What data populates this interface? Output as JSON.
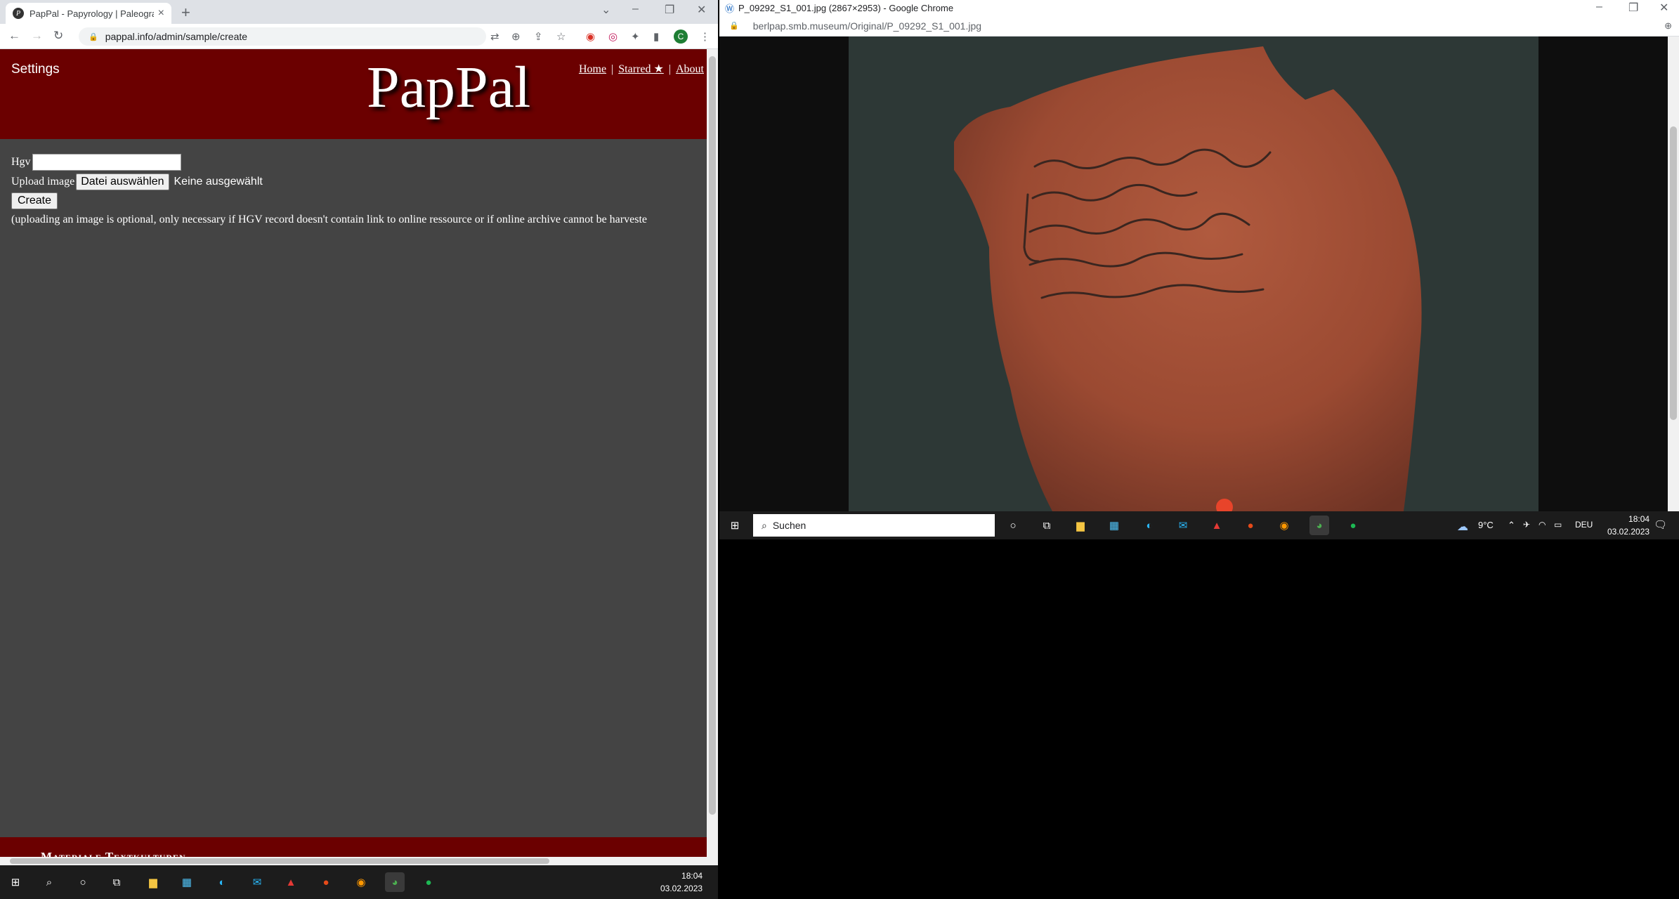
{
  "left_browser": {
    "tab_title": "PapPal - Papyrology | Paleograph",
    "url": "pappal.info/admin/sample/create",
    "profile_initial": "C"
  },
  "page": {
    "settings_label": "Settings",
    "logo_text": "PapPal",
    "nav": {
      "home": "Home",
      "starred": "Starred ★",
      "about": "About"
    },
    "form": {
      "hgv_label": "Hgv",
      "upload_label": "Upload image",
      "file_button": "Datei auswählen",
      "file_status": "Keine ausgewählt",
      "create_button": "Create",
      "note": "(uploading an image is optional, only necessary if HGV record doesn't contain link to online ressource or if online archive cannot be harveste"
    },
    "footer_text": "Materiale Textkulturen"
  },
  "taskbar_left": {
    "time": "18:04",
    "date": "03.02.2023"
  },
  "right_browser": {
    "window_title": "P_09292_S1_001.jpg (2867×2953) - Google Chrome",
    "url": "berlpap.smb.museum/Original/P_09292_S1_001.jpg"
  },
  "taskbar_right": {
    "search_placeholder": "Suchen",
    "weather": "9°C",
    "language": "DEU",
    "time": "18:04",
    "date": "03.02.2023"
  },
  "colors": {
    "header_bg": "#6b0000",
    "page_bg": "#444444"
  }
}
